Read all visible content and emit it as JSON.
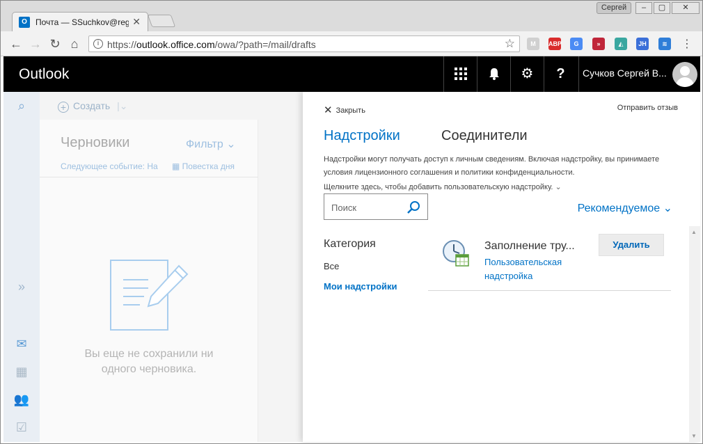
{
  "browser": {
    "tab_title": "Почта — SSuchkov@reg",
    "tab_favicon": "O",
    "tab_close": "✕",
    "profile_name": "Сергей",
    "window_min": "–",
    "window_max": "▢",
    "window_close": "✕",
    "url_scheme": "https://",
    "url_host": "outlook.office.com",
    "url_path": "/owa/?path=/mail/drafts",
    "extensions": [
      {
        "name": "gmail-ext",
        "text": "M",
        "color": "#d0d0d0"
      },
      {
        "name": "adblock-ext",
        "text": "ABP",
        "color": "#d92b2b"
      },
      {
        "name": "translate-ext",
        "text": "G",
        "color": "#4b8bf4"
      },
      {
        "name": "forward-ext",
        "text": "»",
        "color": "#c0263a"
      },
      {
        "name": "vpn-ext",
        "text": "◭",
        "color": "#3aa7a0"
      },
      {
        "name": "jh-ext",
        "text": "JH",
        "color": "#3b6fd8"
      },
      {
        "name": "layers-ext",
        "text": "≋",
        "color": "#2f7ed8"
      }
    ]
  },
  "header": {
    "brand": "Outlook",
    "user_name": "Сучков Сергей В...",
    "buttons": [
      "⋮⋮⋮",
      "🔔",
      "⚙",
      "?"
    ]
  },
  "mail": {
    "create_label": "Создать",
    "folder_title": "Черновики",
    "filter_label": "Фильтр",
    "next_event": "Следующее событие: На",
    "agenda_label": "Повестка дня",
    "empty_text": "Вы еще не сохранили ни одного черновика."
  },
  "panel": {
    "close_label": "Закрыть",
    "feedback_label": "Отправить отзыв",
    "tabs": [
      "Надстройки",
      "Соединители"
    ],
    "description": "Надстройки могут получать доступ к личным сведениям. Включая надстройку, вы принимаете условия лицензионного соглашения и политики конфиденциальности.",
    "custom_link": "Щелкните здесь, чтобы добавить пользовательскую надстройку.",
    "search_placeholder": "Поиск",
    "recommended_label": "Рекомендуемое",
    "category_title": "Категория",
    "categories": [
      "Все",
      "Мои надстройки"
    ],
    "addins": [
      {
        "name": "Заполнение тру...",
        "type": "Пользовательская надстройка",
        "action": "Удалить"
      }
    ]
  },
  "colors": {
    "accent": "#0072c6",
    "header_bg": "#000000"
  }
}
